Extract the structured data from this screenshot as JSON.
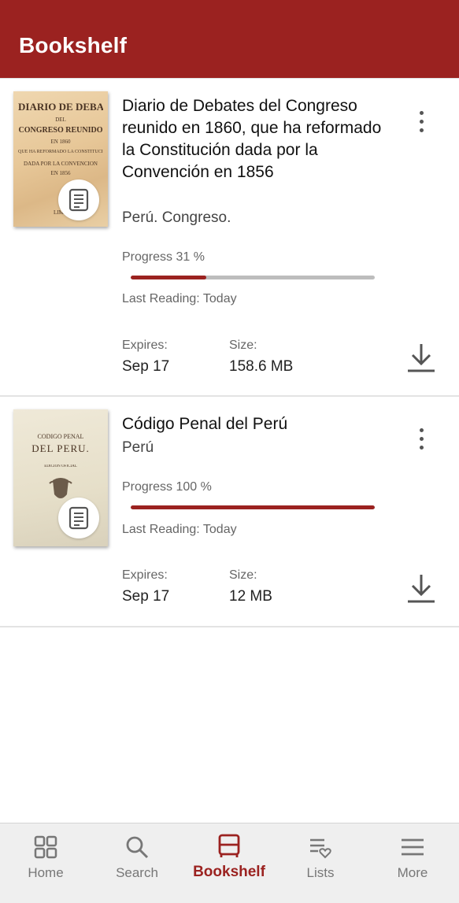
{
  "app": {
    "title": "Bookshelf",
    "accent_color": "#9b2220"
  },
  "books": [
    {
      "title": "Diario de Debates del Congreso reunido en 1860, que ha reformado la Constitución dada por la Convención en 1856",
      "author": "Perú. Congreso.",
      "cover_lines": [
        "DIARIO DE DEBATES",
        "DEL",
        "CONGRESO REUNIDO",
        "EN 1860",
        "QUE HA REFORMADO LA CONSTITUCION",
        "DADA POR LA CONVENCION",
        "EN 1856",
        "LIMA"
      ],
      "cover_badge_icon": "document-icon",
      "progress_label": "Progress 31 %",
      "progress": 0.31,
      "last_reading": "Last Reading: Today",
      "expires_label": "Expires:",
      "expires_value": "Sep 17",
      "size_label": "Size:",
      "size_value": "158.6 MB",
      "menu_icon": "more-vert-icon",
      "download_icon": "download-icon"
    },
    {
      "title": "Código Penal del Perú",
      "author": "Perú",
      "cover_lines": [
        "CODIGO PENAL",
        "DEL PERU.",
        "EDICION OFICIAL"
      ],
      "cover_badge_icon": "document-icon",
      "progress_label": "Progress 100 %",
      "progress": 1.0,
      "last_reading": "Last Reading: Today",
      "expires_label": "Expires:",
      "expires_value": "Sep 17",
      "size_label": "Size:",
      "size_value": "12 MB",
      "menu_icon": "more-vert-icon",
      "download_icon": "download-icon"
    }
  ],
  "bottom_nav": [
    {
      "label": "Home",
      "icon": "grid-icon",
      "active": false
    },
    {
      "label": "Search",
      "icon": "search-icon",
      "active": false
    },
    {
      "label": "Bookshelf",
      "icon": "bookshelf-icon",
      "active": true
    },
    {
      "label": "Lists",
      "icon": "list-heart-icon",
      "active": false
    },
    {
      "label": "More",
      "icon": "menu-icon",
      "active": false
    }
  ]
}
